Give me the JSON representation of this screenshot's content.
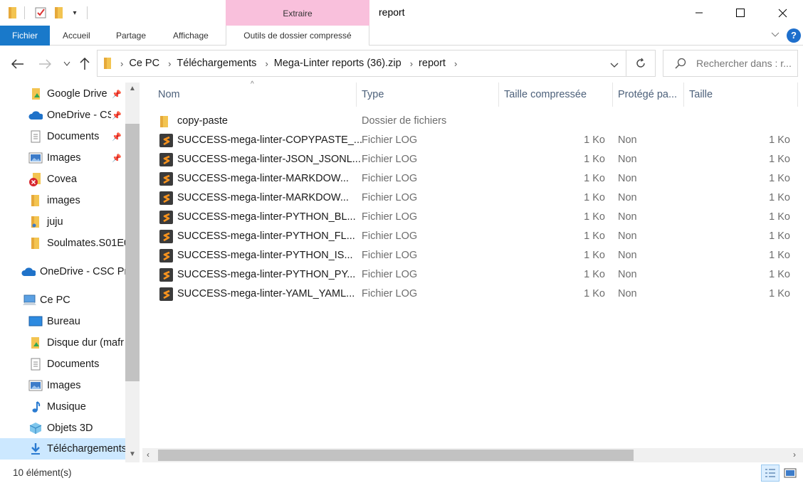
{
  "window": {
    "title": "report",
    "context_tab_group": "Extraire",
    "controls": {
      "minimize": "—",
      "maximize": "☐",
      "close": "✕"
    }
  },
  "ribbon": {
    "tabs": [
      "Fichier",
      "Accueil",
      "Partage",
      "Affichage",
      "Outils de dossier compressé"
    ],
    "help": "?"
  },
  "address_bar": {
    "breadcrumbs": [
      "Ce PC",
      "Téléchargements",
      "Mega-Linter reports (36).zip",
      "report"
    ],
    "search_placeholder": "Rechercher dans : r..."
  },
  "sidebar": {
    "items": [
      {
        "label": "Google Drive",
        "icon": "google-drive-folder-icon",
        "pinned": true
      },
      {
        "label": "OneDrive - CS",
        "icon": "onedrive-cloud-icon",
        "pinned": true
      },
      {
        "label": "Documents",
        "icon": "documents-icon",
        "pinned": true
      },
      {
        "label": "Images",
        "icon": "images-icon",
        "pinned": true
      },
      {
        "label": "Covea",
        "icon": "folder-error-icon",
        "pinned": false
      },
      {
        "label": "images",
        "icon": "folder-icon",
        "pinned": false
      },
      {
        "label": "juju",
        "icon": "folder-icon",
        "pinned": false
      },
      {
        "label": "Soulmates.S01E0",
        "icon": "folder-icon",
        "pinned": false
      },
      {
        "label": "OneDrive - CSC Pr",
        "icon": "onedrive-cloud-icon",
        "pinned": false
      },
      {
        "label": "Ce PC",
        "icon": "computer-icon",
        "pinned": false
      },
      {
        "label": "Bureau",
        "icon": "desktop-icon",
        "pinned": false
      },
      {
        "label": "Disque dur (mafr",
        "icon": "drive-icon",
        "pinned": false
      },
      {
        "label": "Documents",
        "icon": "documents-icon",
        "pinned": false
      },
      {
        "label": "Images",
        "icon": "images-icon",
        "pinned": false
      },
      {
        "label": "Musique",
        "icon": "music-icon",
        "pinned": false
      },
      {
        "label": "Objets 3D",
        "icon": "objects-3d-icon",
        "pinned": false
      },
      {
        "label": "Téléchargements",
        "icon": "downloads-icon",
        "pinned": false
      }
    ]
  },
  "columns": [
    "Nom",
    "Type",
    "Taille compressée",
    "Protégé pa...",
    "Taille"
  ],
  "files": [
    {
      "name": "copy-paste",
      "type": "Dossier de fichiers",
      "compressed": "",
      "protected": "",
      "size": "",
      "kind": "folder"
    },
    {
      "name": "SUCCESS-mega-linter-COPYPASTE_...",
      "type": "Fichier LOG",
      "compressed": "1 Ko",
      "protected": "Non",
      "size": "1 Ko",
      "kind": "log"
    },
    {
      "name": "SUCCESS-mega-linter-JSON_JSONL...",
      "type": "Fichier LOG",
      "compressed": "1 Ko",
      "protected": "Non",
      "size": "1 Ko",
      "kind": "log"
    },
    {
      "name": "SUCCESS-mega-linter-MARKDOW...",
      "type": "Fichier LOG",
      "compressed": "1 Ko",
      "protected": "Non",
      "size": "1 Ko",
      "kind": "log"
    },
    {
      "name": "SUCCESS-mega-linter-MARKDOW...",
      "type": "Fichier LOG",
      "compressed": "1 Ko",
      "protected": "Non",
      "size": "1 Ko",
      "kind": "log"
    },
    {
      "name": "SUCCESS-mega-linter-PYTHON_BL...",
      "type": "Fichier LOG",
      "compressed": "1 Ko",
      "protected": "Non",
      "size": "1 Ko",
      "kind": "log"
    },
    {
      "name": "SUCCESS-mega-linter-PYTHON_FL...",
      "type": "Fichier LOG",
      "compressed": "1 Ko",
      "protected": "Non",
      "size": "1 Ko",
      "kind": "log"
    },
    {
      "name": "SUCCESS-mega-linter-PYTHON_IS...",
      "type": "Fichier LOG",
      "compressed": "1 Ko",
      "protected": "Non",
      "size": "1 Ko",
      "kind": "log"
    },
    {
      "name": "SUCCESS-mega-linter-PYTHON_PY...",
      "type": "Fichier LOG",
      "compressed": "1 Ko",
      "protected": "Non",
      "size": "1 Ko",
      "kind": "log"
    },
    {
      "name": "SUCCESS-mega-linter-YAML_YAML...",
      "type": "Fichier LOG",
      "compressed": "1 Ko",
      "protected": "Non",
      "size": "1 Ko",
      "kind": "log"
    }
  ],
  "status": {
    "count": "10 élément(s)"
  },
  "colors": {
    "accent": "#1979ca",
    "context_tab": "#f9c0dc",
    "selected": "#cce8ff",
    "log_icon_bg": "#3b3b3b",
    "log_icon_fg": "#f7931e"
  }
}
